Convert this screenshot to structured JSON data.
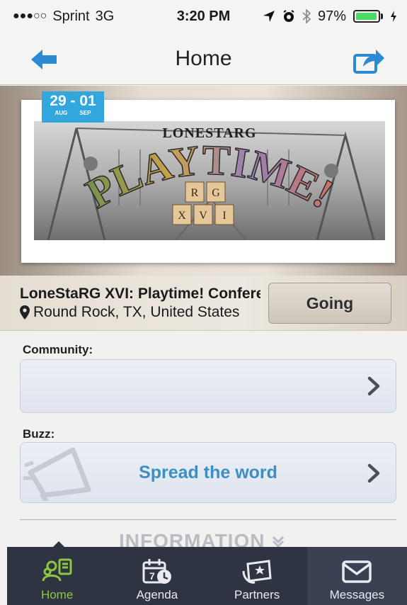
{
  "status_bar": {
    "signal": "●●●○○",
    "carrier": "Sprint",
    "network": "3G",
    "time": "3:20 PM",
    "battery": "97%",
    "battery_level": 0.97,
    "icons": [
      "location-arrow-icon",
      "alarm-icon",
      "bluetooth-icon",
      "battery-icon",
      "charging-icon"
    ]
  },
  "nav": {
    "title": "Home",
    "left_icon": "back-arrow-icon",
    "right_icon": "share-icon"
  },
  "event": {
    "date_range": "29 - 01",
    "start_month": "AUG",
    "end_month": "SEP",
    "banner_org": "LONESTARG",
    "banner_word": "PLAYTIME!",
    "banner_tiles": [
      "R",
      "G",
      "X",
      "V",
      "I"
    ],
    "title": "LoneStaRG XVI: Playtime! Conference",
    "location": "Round Rock, TX, United States",
    "going_label": "Going"
  },
  "community": {
    "label": "Community:"
  },
  "buzz": {
    "label": "Buzz:",
    "action": "Spread the word"
  },
  "information": {
    "header": "INFORMATION"
  },
  "tabs": [
    {
      "label": "Home",
      "icon": "home-people-icon",
      "active": true
    },
    {
      "label": "Agenda",
      "icon": "agenda-calendar-icon",
      "active": false
    },
    {
      "label": "Partners",
      "icon": "partners-ticket-icon",
      "active": false
    },
    {
      "label": "Messages",
      "icon": "envelope-icon",
      "active": false
    }
  ],
  "colors": {
    "accent_blue": "#31a7dd",
    "link_blue": "#3b8fc3",
    "tab_bar": "#2e3442",
    "active_tab": "#8dc63f"
  }
}
